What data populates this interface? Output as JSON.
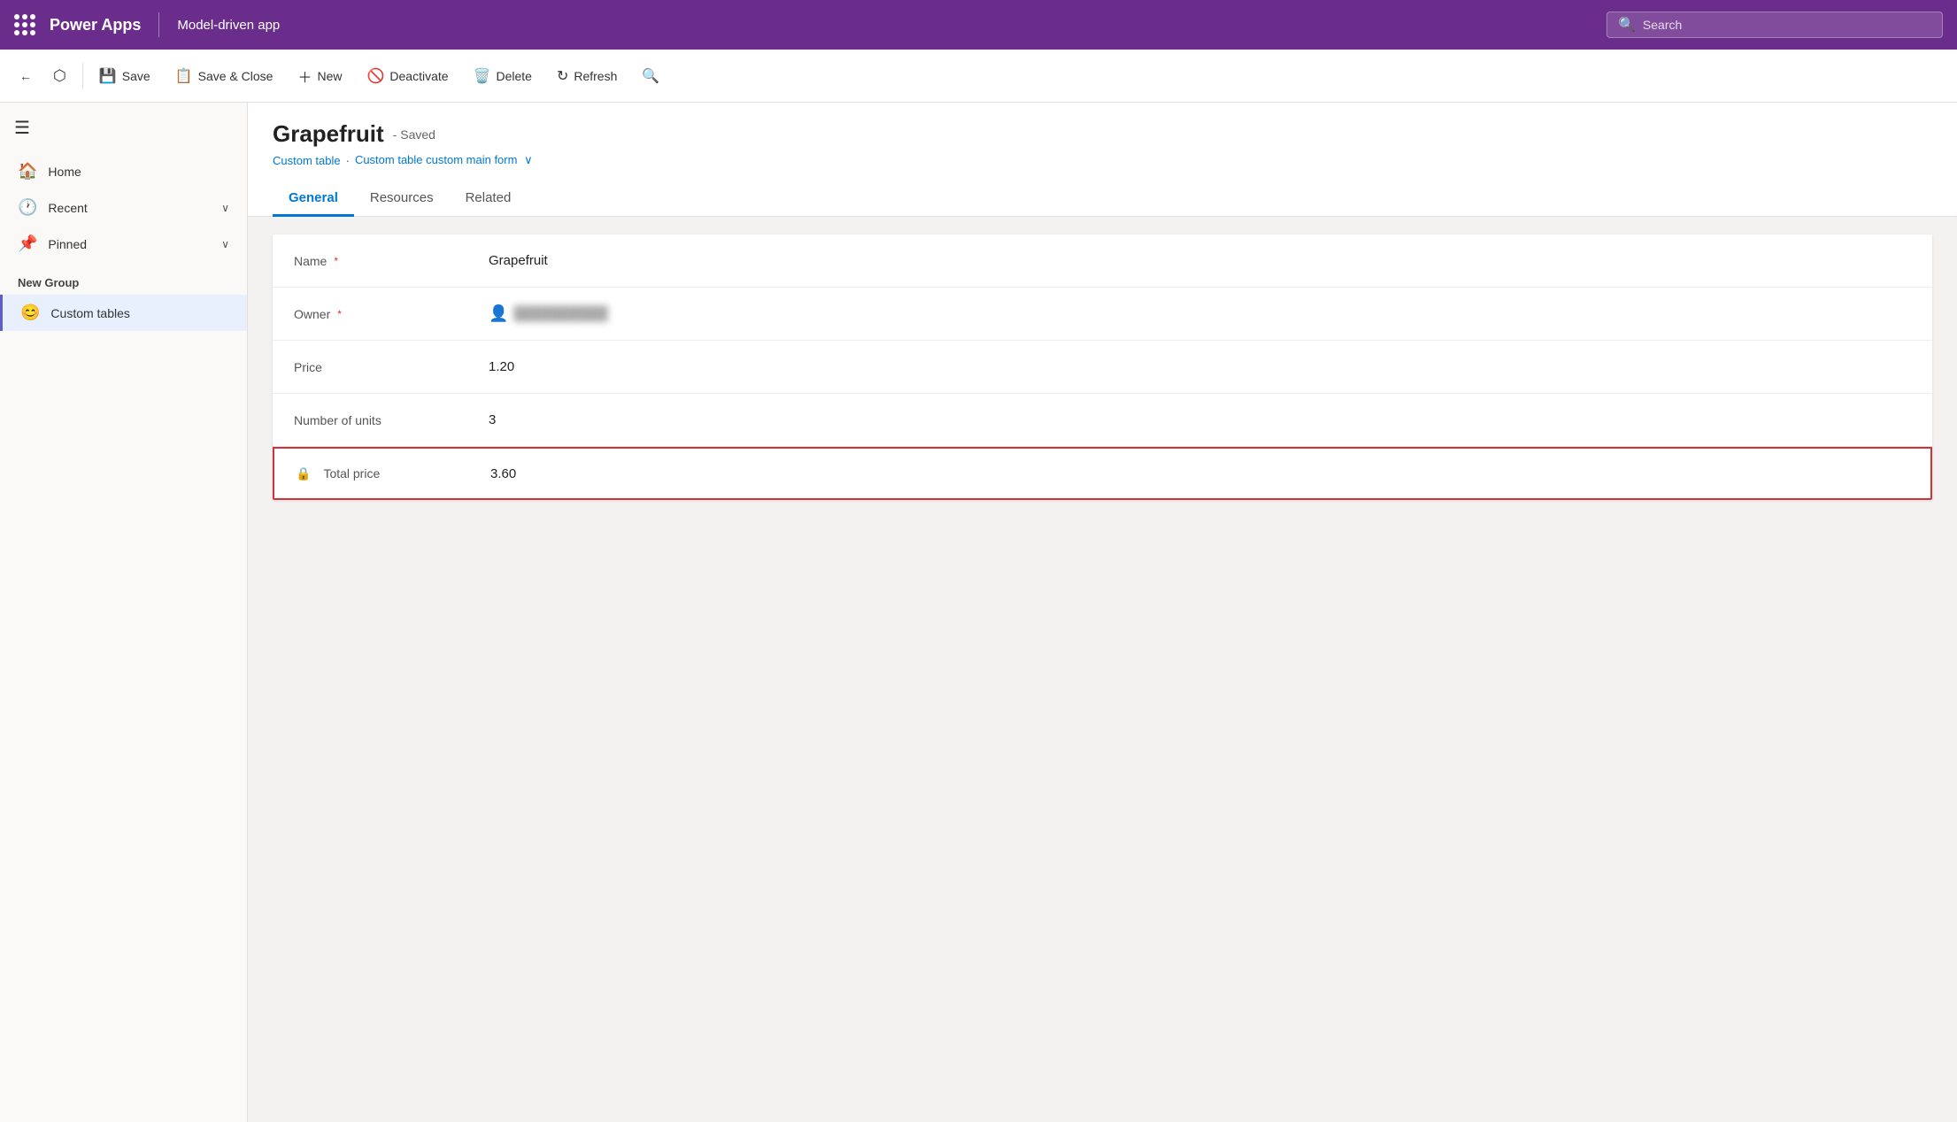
{
  "topbar": {
    "dots_label": "App launcher",
    "title": "Power Apps",
    "divider": true,
    "app_name": "Model-driven app",
    "search_placeholder": "Search"
  },
  "commandbar": {
    "back_label": "←",
    "pop_out_label": "↗",
    "save_label": "Save",
    "save_close_label": "Save & Close",
    "new_label": "New",
    "deactivate_label": "Deactivate",
    "delete_label": "Delete",
    "refresh_label": "Refresh",
    "search_label": "🔍"
  },
  "sidebar": {
    "hamburger": "☰",
    "nav_items": [
      {
        "id": "home",
        "icon": "🏠",
        "label": "Home",
        "has_arrow": false
      },
      {
        "id": "recent",
        "icon": "🕐",
        "label": "Recent",
        "has_arrow": true
      },
      {
        "id": "pinned",
        "icon": "📌",
        "label": "Pinned",
        "has_arrow": true
      }
    ],
    "group_label": "New Group",
    "group_items": [
      {
        "id": "custom-tables",
        "icon": "😊",
        "label": "Custom tables",
        "active": true
      }
    ]
  },
  "record": {
    "title": "Grapefruit",
    "saved_badge": "- Saved",
    "breadcrumb_table": "Custom table",
    "breadcrumb_separator": "·",
    "breadcrumb_form": "Custom table custom main form",
    "breadcrumb_chevron": "∨"
  },
  "tabs": [
    {
      "id": "general",
      "label": "General",
      "active": true
    },
    {
      "id": "resources",
      "label": "Resources",
      "active": false
    },
    {
      "id": "related",
      "label": "Related",
      "active": false
    }
  ],
  "form": {
    "fields": [
      {
        "id": "name",
        "label": "Name",
        "required": true,
        "value": "Grapefruit",
        "type": "text",
        "blurred": false,
        "highlighted": false
      },
      {
        "id": "owner",
        "label": "Owner",
        "required": true,
        "value": "██████████",
        "type": "owner",
        "blurred": true,
        "highlighted": false
      },
      {
        "id": "price",
        "label": "Price",
        "required": false,
        "value": "1.20",
        "type": "text",
        "blurred": false,
        "highlighted": false
      },
      {
        "id": "number-of-units",
        "label": "Number of units",
        "required": false,
        "value": "3",
        "type": "text",
        "blurred": false,
        "highlighted": false
      },
      {
        "id": "total-price",
        "label": "Total price",
        "required": false,
        "value": "3.60",
        "type": "locked",
        "blurred": false,
        "highlighted": true
      }
    ]
  }
}
